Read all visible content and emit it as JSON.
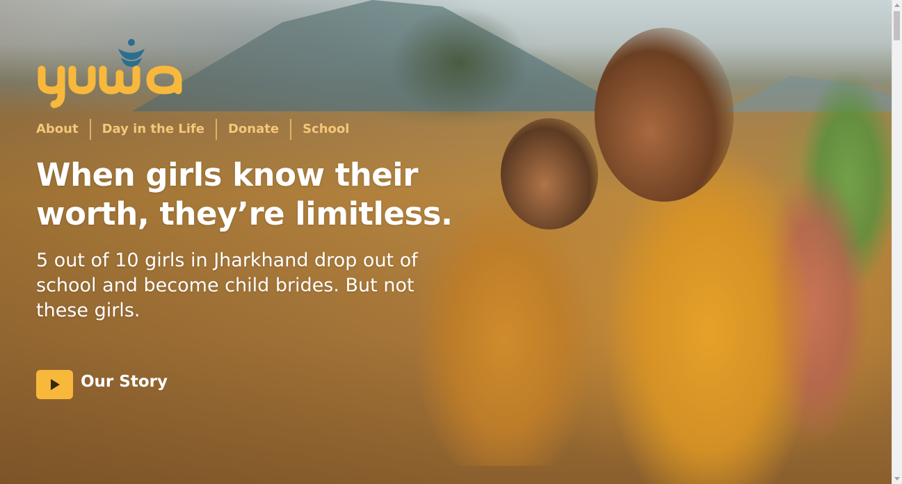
{
  "brand": {
    "logo_text": "yuwa",
    "logo_color": "#f8b83c",
    "accent_color": "#2b6e8f",
    "icon": "lotus-icon"
  },
  "nav": {
    "items": [
      {
        "label": "About"
      },
      {
        "label": "Day in the Life"
      },
      {
        "label": "Donate"
      },
      {
        "label": "School"
      }
    ],
    "color": "#f6c77a"
  },
  "hero": {
    "headline_line1": "When girls know their",
    "headline_line2": "worth, they’re limitless.",
    "subhead": "5 out of 10 girls in Jharkhand drop out of school and become child brides. But not these girls.",
    "cta_label": "Our Story",
    "cta_icon": "play-icon",
    "cta_color": "#f8b83c"
  },
  "scrollbar": {
    "up_icon": "chevron-up-icon",
    "down_icon": "chevron-down-icon"
  }
}
